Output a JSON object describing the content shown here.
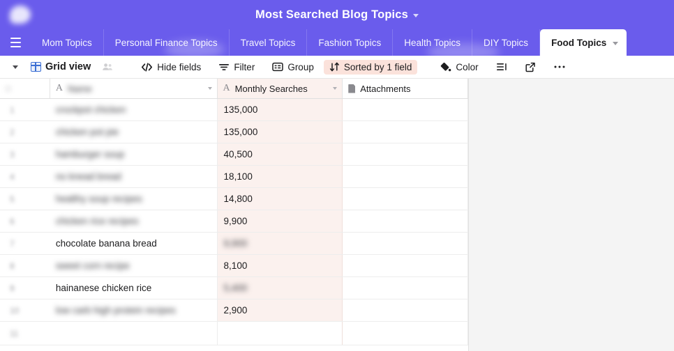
{
  "topbar": {
    "logo_icon": "airtable-logo-icon",
    "workspace_title": "Most Searched Blog Topics",
    "title_caret_icon": "chevron-down-icon"
  },
  "tabs": {
    "menu_icon": "hamburger-menu-icon",
    "items": [
      {
        "label": "Mom Topics",
        "active": false
      },
      {
        "label": "Personal Finance Topics",
        "active": false
      },
      {
        "label": "Travel Topics",
        "active": false
      },
      {
        "label": "Fashion Topics",
        "active": false
      },
      {
        "label": "Health Topics",
        "active": false
      },
      {
        "label": "DIY Topics",
        "active": false
      },
      {
        "label": "Food Topics",
        "active": true
      }
    ]
  },
  "toolbar": {
    "view_caret_icon": "chevron-down-icon",
    "grid_icon": "grid-view-icon",
    "view_label": "Grid view",
    "collaborators_icon": "collaborators-icon",
    "hide_fields_icon": "hide-fields-icon",
    "hide_fields_label": "Hide fields",
    "filter_icon": "filter-icon",
    "filter_label": "Filter",
    "group_icon": "group-icon",
    "group_label": "Group",
    "sort_icon": "sort-icon",
    "sort_label": "Sorted by 1 field",
    "sort_badge_color": "#FBE2DB",
    "color_icon": "color-paint-icon",
    "color_label": "Color",
    "row_height_icon": "row-height-icon",
    "share_icon": "share-export-icon",
    "more_icon": "more-horizontal-icon"
  },
  "grid": {
    "columns": [
      {
        "name": "row-gutter",
        "label": "",
        "type": "gutter"
      },
      {
        "name": "name-column",
        "label": "Name",
        "type": "text",
        "blurred": true
      },
      {
        "name": "monthly-searches-column",
        "label": "Monthly Searches",
        "type": "text",
        "field_icon": "text-field-icon"
      },
      {
        "name": "attachments-column",
        "label": "Attachments",
        "type": "attachment",
        "field_icon": "attachment-icon"
      }
    ],
    "rows": [
      {
        "num": "1",
        "name": "crockpot chicken",
        "name_blurred": true,
        "searches": "135,000",
        "searches_blurred": false
      },
      {
        "num": "2",
        "name": "chicken pot pie",
        "name_blurred": true,
        "searches": "135,000",
        "searches_blurred": false
      },
      {
        "num": "3",
        "name": "hamburger soup",
        "name_blurred": true,
        "searches": "40,500",
        "searches_blurred": false
      },
      {
        "num": "4",
        "name": "no knead bread",
        "name_blurred": true,
        "searches": "18,100",
        "searches_blurred": false
      },
      {
        "num": "5",
        "name": "healthy soup recipes",
        "name_blurred": true,
        "searches": "14,800",
        "searches_blurred": false
      },
      {
        "num": "6",
        "name": "chicken rice recipes",
        "name_blurred": true,
        "searches": "9,900",
        "searches_blurred": false
      },
      {
        "num": "7",
        "name": "chocolate banana bread",
        "name_blurred": false,
        "searches": "9,900",
        "searches_blurred": true
      },
      {
        "num": "8",
        "name": "sweet corn recipe",
        "name_blurred": true,
        "searches": "8,100",
        "searches_blurred": false
      },
      {
        "num": "9",
        "name": "hainanese chicken rice",
        "name_blurred": false,
        "searches": "5,400",
        "searches_blurred": true
      },
      {
        "num": "10",
        "name": "low carb high protein recipes",
        "name_blurred": true,
        "searches": "2,900",
        "searches_blurred": false
      },
      {
        "num": "11",
        "name": "",
        "name_blurred": false,
        "searches": "",
        "searches_blurred": false
      }
    ]
  },
  "colors": {
    "brand_purple": "#6A5CEC",
    "sorted_pink": "#FBE2DB",
    "sorted_column_bg": "#FBF1EE",
    "canvas_gray": "#F4F4F4"
  }
}
